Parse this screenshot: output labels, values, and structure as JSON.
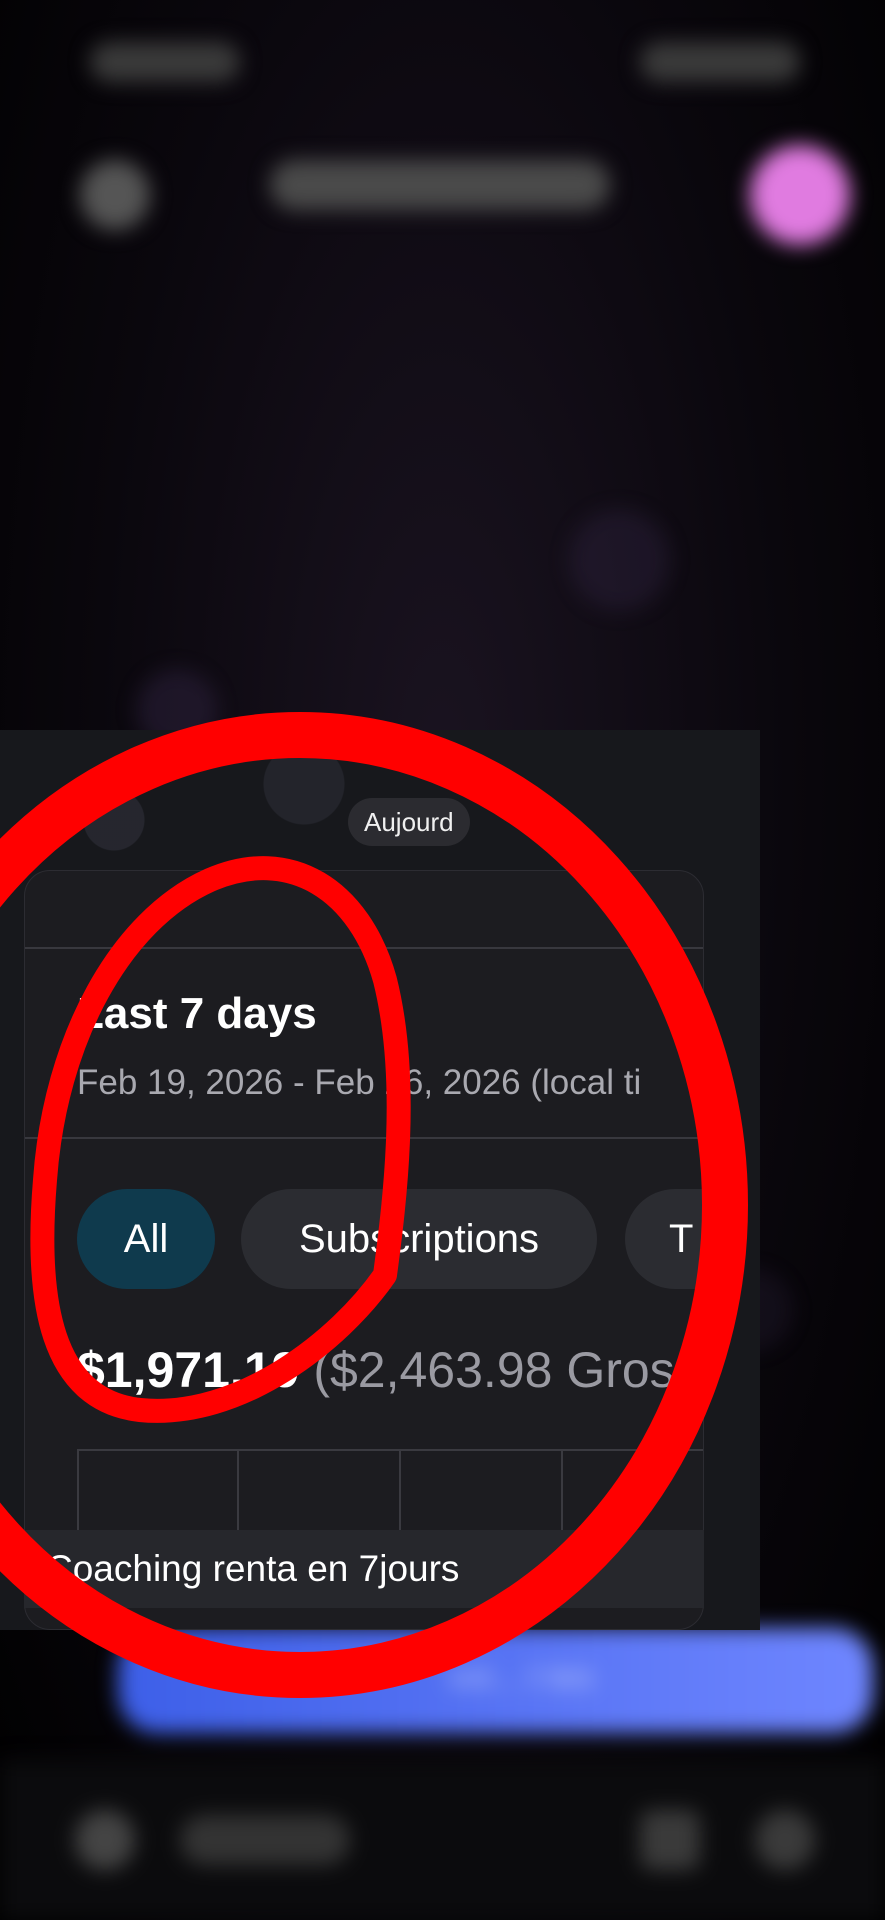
{
  "chat_banner": {
    "date": "Aujourd"
  },
  "card": {
    "title": "Last 7 days",
    "subtitle": "Feb 19, 2026 - Feb 26, 2026 (local ti",
    "filters": [
      {
        "label": "All",
        "selected": true
      },
      {
        "label": "Subscriptions",
        "selected": false
      },
      {
        "label": "T",
        "selected": false
      }
    ],
    "net_amount": "$1,971.19",
    "gross_amount": "($2,463.98 Gros"
  },
  "message_caption": "Coaching renta en 7jours",
  "bottom_button_label": "voi... t tes",
  "colors": {
    "accent_blue": "#4a6cf7",
    "annotation_red": "#ff0000",
    "chip_selected": "#0f3a4d",
    "avatar": "#e07be0"
  },
  "icons": [
    "back-arrow-icon",
    "profile-avatar",
    "attachment-icon",
    "emoji-icon",
    "mic-icon"
  ]
}
